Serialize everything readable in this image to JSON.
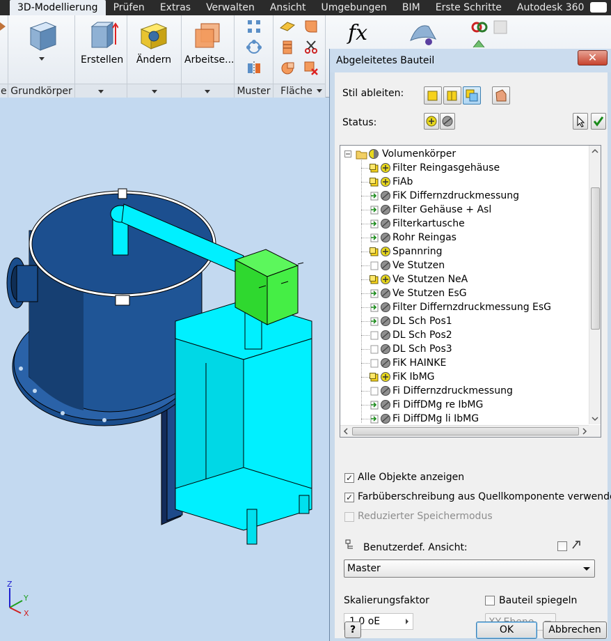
{
  "ribbon_tabs": {
    "items": [
      "3D-Modellierung",
      "Prüfen",
      "Extras",
      "Verwalten",
      "Ansicht",
      "Umgebungen",
      "BIM",
      "Erste Schritte",
      "Autodesk 360"
    ],
    "active": "3D-Modellierung"
  },
  "ribbon": {
    "grundkoerper_title": "Grundkörper",
    "erstellen_label": "Erstellen",
    "aendern_label": "Ändern",
    "arbeitse_label": "Arbeitse...",
    "muster_title": "Muster",
    "flaeche_title": "Fläche",
    "fx_label": "fx",
    "left_edge_fragment": "e"
  },
  "dialog": {
    "title": "Abgeleitetes Bauteil",
    "close_glyph": "✕",
    "stil_label": "Stil ableiten:",
    "status_label": "Status:",
    "tree": {
      "root": "Volumenkörper",
      "items": [
        {
          "label": "Filter Reingasgehäuse",
          "state": "include"
        },
        {
          "label": "FiAb",
          "state": "include"
        },
        {
          "label": "FiK Differnzdruckmessung",
          "state": "exclude"
        },
        {
          "label": "Filter Gehäuse + Asl",
          "state": "exclude"
        },
        {
          "label": "Filterkartusche",
          "state": "exclude"
        },
        {
          "label": "Rohr Reingas",
          "state": "exclude"
        },
        {
          "label": "Spannring",
          "state": "include"
        },
        {
          "label": "Ve Stutzen",
          "state": "exclude-plain"
        },
        {
          "label": "Ve Stutzen NeA",
          "state": "include"
        },
        {
          "label": "Ve Stutzen EsG",
          "state": "exclude"
        },
        {
          "label": "Filter Differnzdruckmessung EsG",
          "state": "exclude"
        },
        {
          "label": "DL Sch Pos1",
          "state": "exclude"
        },
        {
          "label": "DL Sch Pos2",
          "state": "exclude-plain"
        },
        {
          "label": "DL Sch Pos3",
          "state": "exclude-plain"
        },
        {
          "label": "FiK HAINKE",
          "state": "exclude-plain"
        },
        {
          "label": "FiK IbMG",
          "state": "include"
        },
        {
          "label": "Fi Differnzdruckmessung",
          "state": "exclude-plain"
        },
        {
          "label": "Fi DiffDMg re IbMG",
          "state": "exclude"
        },
        {
          "label": "Fi DiffDMg li IbMG",
          "state": "exclude"
        }
      ]
    },
    "options": {
      "alle_objekte": "Alle Objekte anzeigen",
      "farbueberschreibung": "Farbüberschreibung aus Quellkomponente verwenden",
      "reduzierter": "Reduzierter Speichermodus"
    },
    "benutzerdef_label": "Benutzerdef. Ansicht:",
    "view_combo_value": "Master",
    "skalierung_label": "Skalierungsfaktor",
    "skalierung_value": "1,0 oE",
    "spiegeln_label": "Bauteil spiegeln",
    "ebene_value": "XY-Ebene",
    "help_glyph": "?",
    "ok_label": "OK",
    "cancel_label": "Abbrechen"
  },
  "axis": {
    "z": "Z",
    "y": "Y",
    "x": "X"
  },
  "colors": {
    "ribbon_tab_bg": "#2b2b2b",
    "viewport_bg": "#c3d9f0",
    "housing_blue": "#1a4d8c",
    "cyan": "#00f0ff",
    "green_box": "#3cf23c",
    "dialog_bg": "#f0f0f0"
  }
}
